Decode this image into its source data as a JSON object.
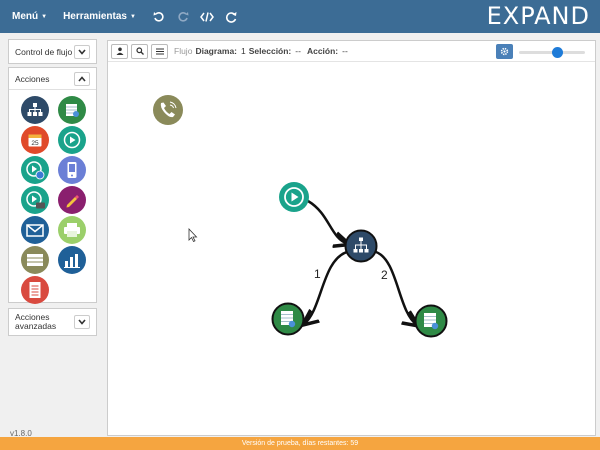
{
  "menubar": {
    "menu_label": "Menú",
    "tools_label": "Herramientas"
  },
  "brand": "EXPAND",
  "sidebar": {
    "control_flow_label": "Control de flujo",
    "actions_label": "Acciones",
    "advanced_label_line1": "Acciones",
    "advanced_label_line2": "avanzadas",
    "calendar_day": "25",
    "version": "v1.8.0"
  },
  "toolbar": {
    "flow_label": "Flujo",
    "diagram_label": "Diagrama:",
    "diagram_value": "1",
    "selection_label": "Selección:",
    "selection_value": "--",
    "action_label": "Acción:",
    "action_value": "--",
    "zoom_level": 0.6
  },
  "diagram": {
    "edge_labels": [
      "1",
      "2"
    ]
  },
  "footer": "Versión de prueba, días restantes: 59"
}
